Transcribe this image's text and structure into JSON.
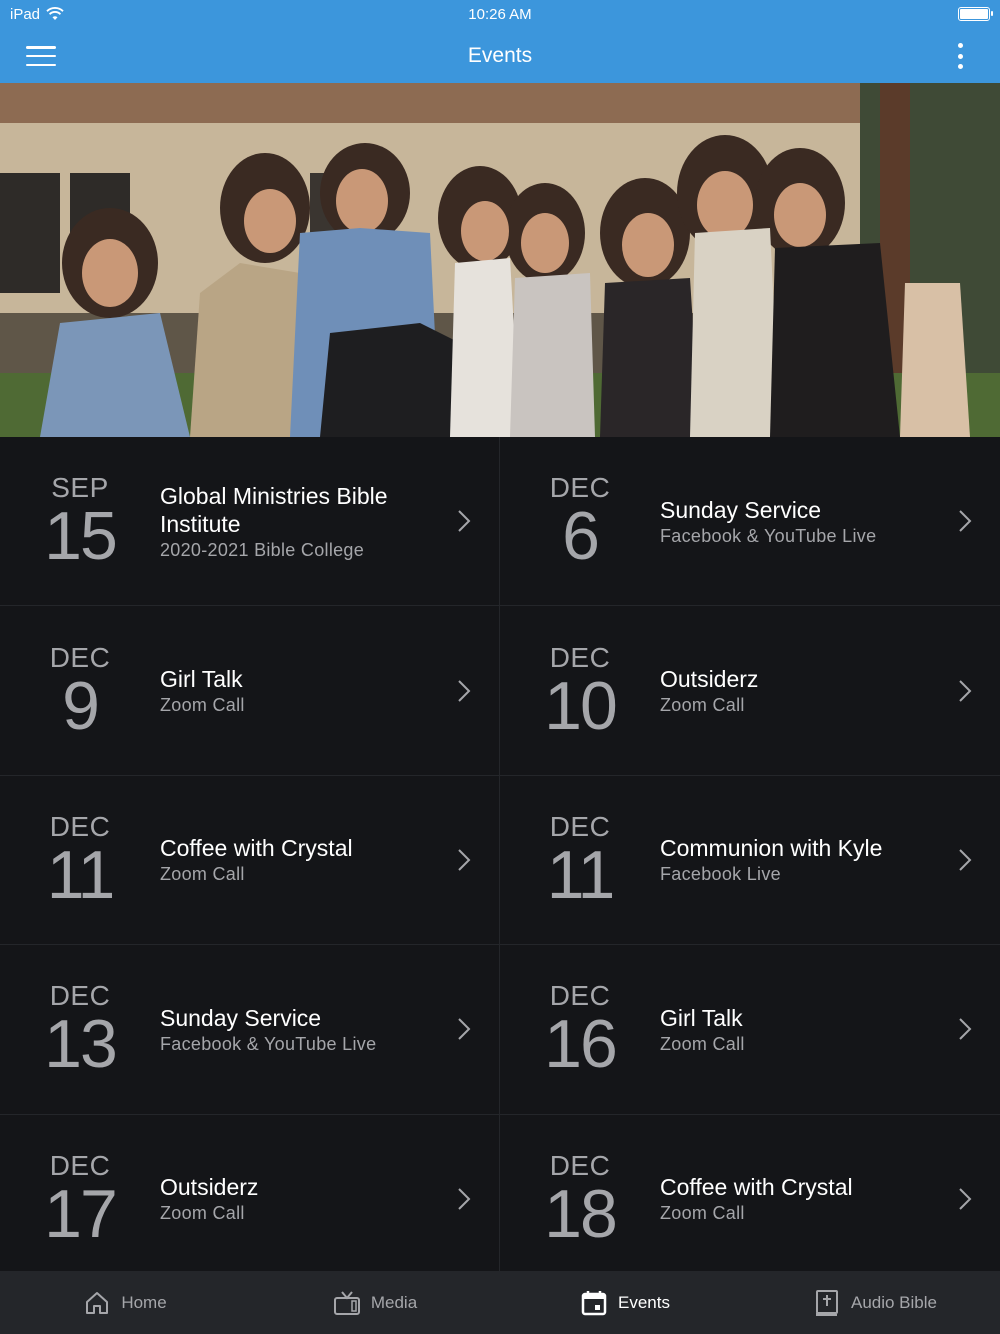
{
  "status": {
    "device": "iPad",
    "time": "10:26 AM"
  },
  "header": {
    "title": "Events"
  },
  "events": [
    {
      "month": "SEP",
      "day": "15",
      "title": "Global Ministries Bible Institute",
      "subtitle": "2020-2021 Bible College"
    },
    {
      "month": "DEC",
      "day": "6",
      "title": "Sunday Service",
      "subtitle": "Facebook & YouTube Live"
    },
    {
      "month": "DEC",
      "day": "9",
      "title": "Girl Talk",
      "subtitle": "Zoom Call"
    },
    {
      "month": "DEC",
      "day": "10",
      "title": "Outsiderz",
      "subtitle": "Zoom Call"
    },
    {
      "month": "DEC",
      "day": "11",
      "title": "Coffee with Crystal",
      "subtitle": "Zoom Call"
    },
    {
      "month": "DEC",
      "day": "11",
      "title": "Communion with Kyle",
      "subtitle": "Facebook Live"
    },
    {
      "month": "DEC",
      "day": "13",
      "title": "Sunday Service",
      "subtitle": "Facebook & YouTube Live"
    },
    {
      "month": "DEC",
      "day": "16",
      "title": "Girl Talk",
      "subtitle": "Zoom Call"
    },
    {
      "month": "DEC",
      "day": "17",
      "title": "Outsiderz",
      "subtitle": "Zoom Call"
    },
    {
      "month": "DEC",
      "day": "18",
      "title": "Coffee with Crystal",
      "subtitle": "Zoom Call"
    }
  ],
  "tabs": [
    {
      "label": "Home",
      "icon": "home-icon"
    },
    {
      "label": "Media",
      "icon": "tv-icon"
    },
    {
      "label": "Events",
      "icon": "calendar-icon",
      "active": true
    },
    {
      "label": "Audio Bible",
      "icon": "bible-icon"
    }
  ],
  "colors": {
    "accent": "#3c96dc",
    "background": "#141518",
    "tabbar": "#24262a",
    "muted": "#a5a6aa"
  }
}
